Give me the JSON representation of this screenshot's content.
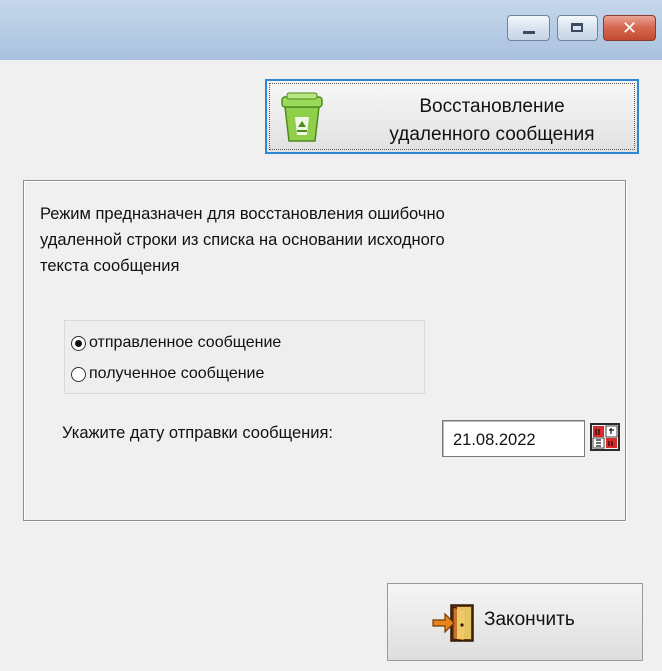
{
  "window": {
    "controls": [
      "minimize-icon",
      "maximize-icon",
      "close-icon"
    ],
    "close_glyph": "✕"
  },
  "restore_button": {
    "label_line1": "Восстановление",
    "label_line2": "удаленного сообщения",
    "icon": "recycle-bin-icon"
  },
  "description": {
    "line1": "Режим предназначен для восстановления ошибочно",
    "line2": "удаленной строки из списка на основании исходного",
    "line3": "текста сообщения"
  },
  "message_type": {
    "options": [
      {
        "label": "отправленное сообщение",
        "checked": true
      },
      {
        "label": "полученное сообщение",
        "checked": false
      }
    ]
  },
  "date": {
    "label": "Укажите дату отправки сообщения:",
    "value": "21.08.2022",
    "picker_icon": "calendar-icon"
  },
  "finish_button": {
    "label": "Закончить",
    "icon": "exit-door-icon"
  },
  "colors": {
    "focus_border": "#2e86d6",
    "bin_green": "#7cc23c",
    "close_red": "#c44a31"
  }
}
